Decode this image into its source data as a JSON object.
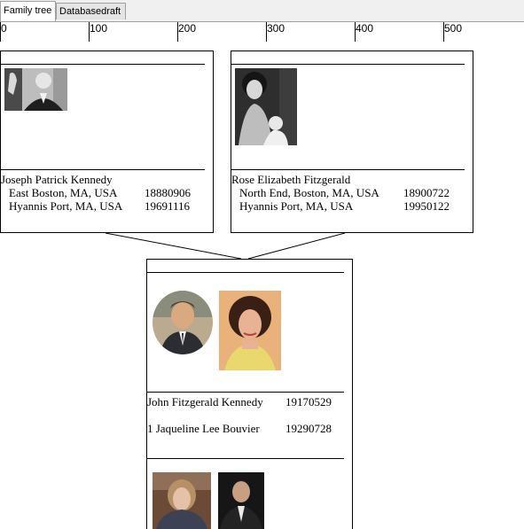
{
  "tabs": [
    {
      "label": "Family tree",
      "active": true
    },
    {
      "label": "Databasedraft",
      "active": false
    }
  ],
  "ruler": {
    "ticks": [
      "0",
      "100",
      "200",
      "300",
      "400",
      "500"
    ]
  },
  "persons": {
    "father": {
      "name": "Joseph Patrick Kennedy",
      "birth_place": "East Boston, MA, USA",
      "birth_date": "18880906",
      "death_place": "Hyannis Port, MA, USA",
      "death_date": "19691116"
    },
    "mother": {
      "name": "Rose Elizabeth Fitzgerald",
      "birth_place": "North End, Boston, MA, USA",
      "birth_date": "18900722",
      "death_place": "Hyannis Port, MA, USA",
      "death_date": "19950122"
    },
    "couple": {
      "husband_name": "John Fitzgerald Kennedy",
      "husband_date": "19170529",
      "wife_name": "1 Jaqueline Lee Bouvier",
      "wife_date": "19290728"
    }
  },
  "colors": {
    "tabbar_bg": "#f0f0f0",
    "border": "#000000"
  }
}
